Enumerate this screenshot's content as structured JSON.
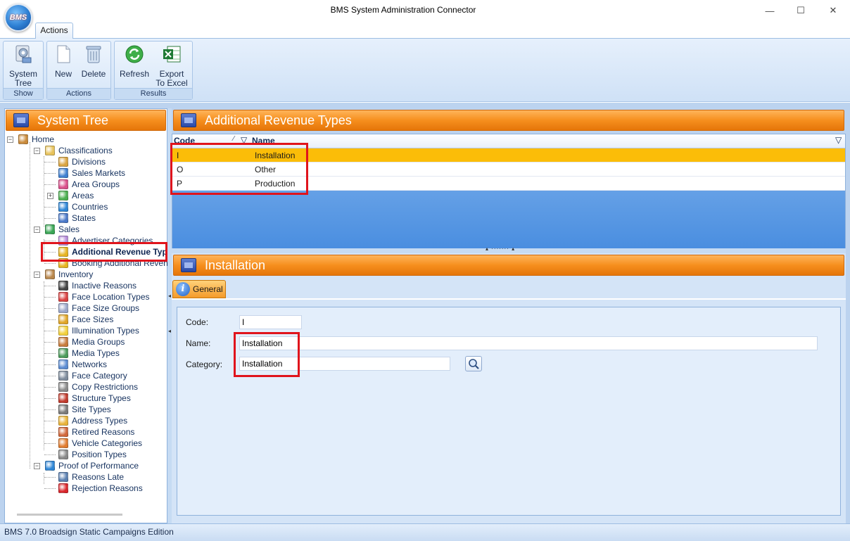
{
  "window": {
    "title": "BMS System Administration Connector",
    "logo_text": "BMS",
    "minimize_glyph": "—",
    "maximize_glyph": "☐",
    "close_glyph": "✕"
  },
  "ribbon": {
    "tab": "Actions",
    "groups": [
      {
        "caption": "Show",
        "buttons": [
          {
            "label_line1": "System",
            "label_line2": "Tree",
            "icon": "system-tree-icon"
          }
        ]
      },
      {
        "caption": "Actions",
        "buttons": [
          {
            "label_line1": "New",
            "label_line2": "",
            "icon": "new-document-icon"
          },
          {
            "label_line1": "Delete",
            "label_line2": "",
            "icon": "recycle-bin-icon"
          }
        ]
      },
      {
        "caption": "Results",
        "buttons": [
          {
            "label_line1": "Refresh",
            "label_line2": "",
            "icon": "refresh-icon"
          },
          {
            "label_line1": "Export",
            "label_line2": "To Excel",
            "icon": "excel-icon"
          }
        ]
      }
    ]
  },
  "system_tree": {
    "header": "System Tree",
    "items": [
      {
        "label": "Home",
        "icon": "home-icon",
        "color": "#c98a3a"
      },
      {
        "label": "Classifications",
        "icon": "folder-icon",
        "color": "#e7c25a"
      },
      {
        "label": "Divisions",
        "icon": "divisions-icon",
        "color": "#d9a441"
      },
      {
        "label": "Sales Markets",
        "icon": "globe-icon",
        "color": "#3f7fcf"
      },
      {
        "label": "Area Groups",
        "icon": "area-groups-icon",
        "color": "#d94f8a"
      },
      {
        "label": "Areas",
        "icon": "areas-icon",
        "color": "#4caf50"
      },
      {
        "label": "Countries",
        "icon": "globe-icon",
        "color": "#2f86d6"
      },
      {
        "label": "States",
        "icon": "states-icon",
        "color": "#4a78c8"
      },
      {
        "label": "Sales",
        "icon": "sales-icon",
        "color": "#3aa655"
      },
      {
        "label": "Advertiser Categories",
        "icon": "advertiser-categories-icon",
        "color": "#b58ad9"
      },
      {
        "label": "Additional Revenue Typ",
        "icon": "revenue-icon",
        "color": "#e6b422"
      },
      {
        "label": "Booking Additional Reven",
        "icon": "booking-revenue-icon",
        "color": "#e6b422"
      },
      {
        "label": "Inventory",
        "icon": "inventory-icon",
        "color": "#b8864b"
      },
      {
        "label": "Inactive Reasons",
        "icon": "traffic-light-icon",
        "color": "#444444"
      },
      {
        "label": "Face Location Types",
        "icon": "face-location-icon",
        "color": "#d94141"
      },
      {
        "label": "Face Size Groups",
        "icon": "face-size-groups-icon",
        "color": "#9aa6c9"
      },
      {
        "label": "Face Sizes",
        "icon": "face-sizes-icon",
        "color": "#e0a526"
      },
      {
        "label": "Illumination Types",
        "icon": "lightbulb-icon",
        "color": "#f2d03b"
      },
      {
        "label": "Media Groups",
        "icon": "media-groups-icon",
        "color": "#c77b3c"
      },
      {
        "label": "Media Types",
        "icon": "media-types-icon",
        "color": "#4a9a5a"
      },
      {
        "label": "Networks",
        "icon": "networks-icon",
        "color": "#5b8bd1"
      },
      {
        "label": "Face Category",
        "icon": "face-category-icon",
        "color": "#7f8c9c"
      },
      {
        "label": "Copy Restrictions",
        "icon": "lock-icon",
        "color": "#8a8a8a"
      },
      {
        "label": "Structure Types",
        "icon": "structure-types-icon",
        "color": "#c0392b"
      },
      {
        "label": "Site Types",
        "icon": "site-types-icon",
        "color": "#7a7a7a"
      },
      {
        "label": "Address Types",
        "icon": "envelope-icon",
        "color": "#e8b339"
      },
      {
        "label": "Retired Reasons",
        "icon": "retired-reasons-icon",
        "color": "#d0663a"
      },
      {
        "label": "Vehicle Categories",
        "icon": "vehicle-icon",
        "color": "#e07b2e"
      },
      {
        "label": "Position Types",
        "icon": "position-icon",
        "color": "#888888"
      },
      {
        "label": "Proof of Performance",
        "icon": "globe-icon",
        "color": "#2f86d6"
      },
      {
        "label": "Reasons Late",
        "icon": "clock-icon",
        "color": "#5a7fb0"
      },
      {
        "label": "Rejection Reasons",
        "icon": "red-x-icon",
        "color": "#d9252b"
      }
    ]
  },
  "grid": {
    "header": "Additional Revenue Types",
    "columns": [
      "Code",
      "Name"
    ],
    "rows": [
      {
        "code": "I",
        "name": "Installation",
        "selected": true
      },
      {
        "code": "O",
        "name": "Other",
        "selected": false
      },
      {
        "code": "P",
        "name": "Production",
        "selected": false
      }
    ]
  },
  "detail": {
    "header": "Installation",
    "tab": "General",
    "info_glyph": "i",
    "fields": {
      "code_label": "Code:",
      "code_value": "I",
      "name_label": "Name:",
      "name_value": "Installation",
      "category_label": "Category:",
      "category_value": "Installation"
    }
  },
  "status": {
    "text": "BMS 7.0 Broadsign Static Campaigns  Edition"
  },
  "colors": {
    "accent_orange": "#f68f1e",
    "selection": "#fbbd08",
    "highlight_red": "#e0141c",
    "panel_blue": "#bcd3ef"
  }
}
